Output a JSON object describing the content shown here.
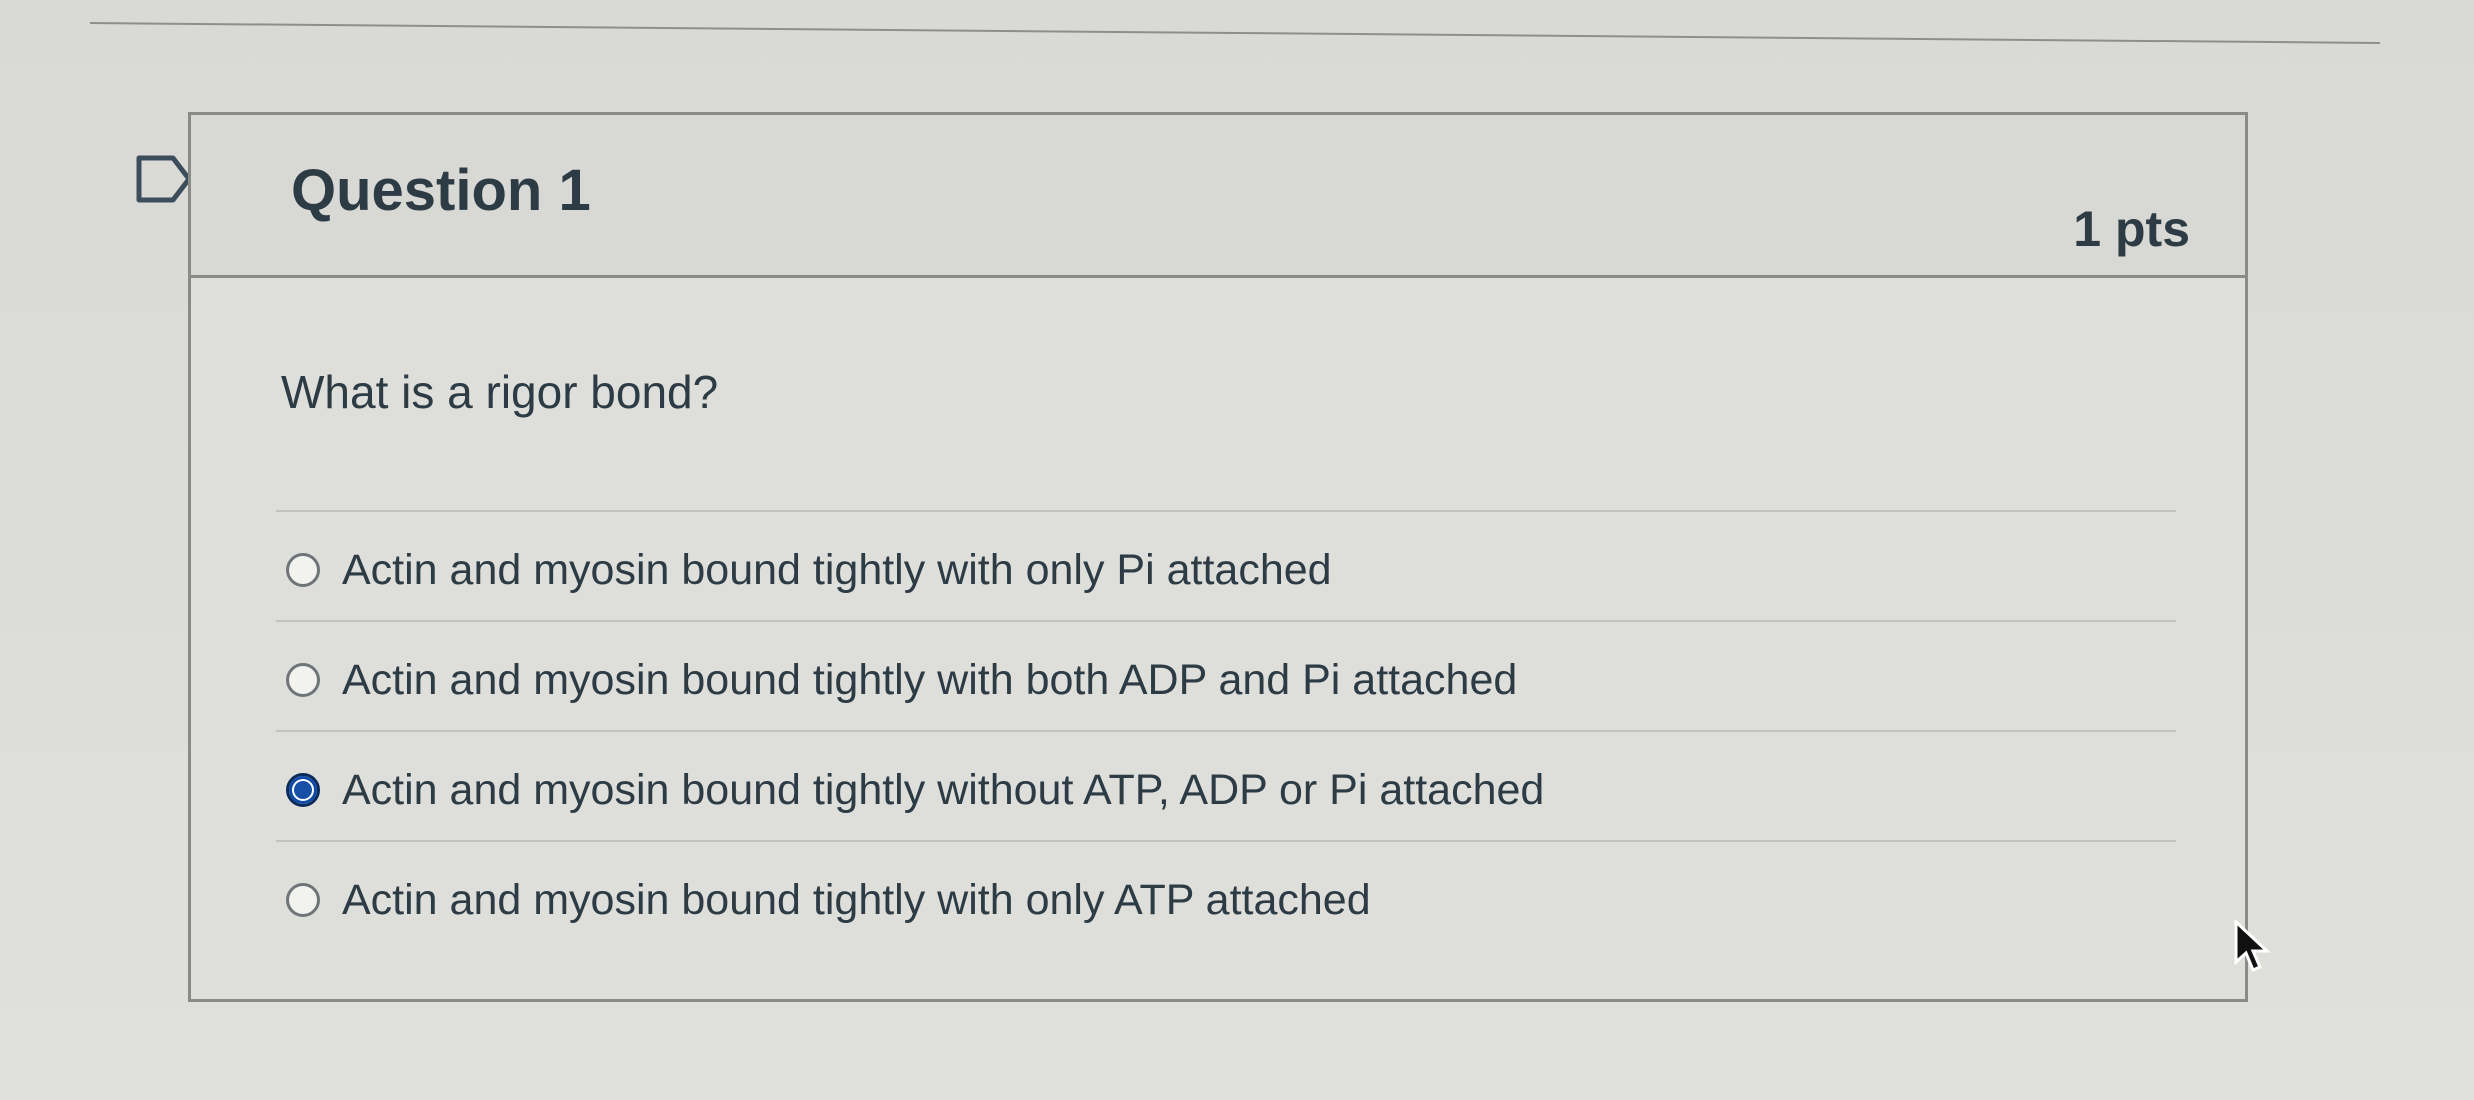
{
  "question": {
    "title": "Question 1",
    "points": "1 pts",
    "text": "What is a rigor bond?",
    "answers": [
      {
        "label": "Actin and myosin bound tightly with only Pi attached",
        "selected": false
      },
      {
        "label": "Actin and myosin bound tightly with both ADP and Pi attached",
        "selected": false
      },
      {
        "label": "Actin and myosin bound tightly without ATP, ADP or Pi attached",
        "selected": true
      },
      {
        "label": "Actin and myosin bound tightly with only ATP attached",
        "selected": false
      }
    ]
  },
  "icons": {
    "flag": "flag-icon",
    "cursor": "cursor-icon"
  },
  "colors": {
    "text": "#2d3b45",
    "radio_selected": "#174ea6",
    "border": "#8a8a88"
  }
}
